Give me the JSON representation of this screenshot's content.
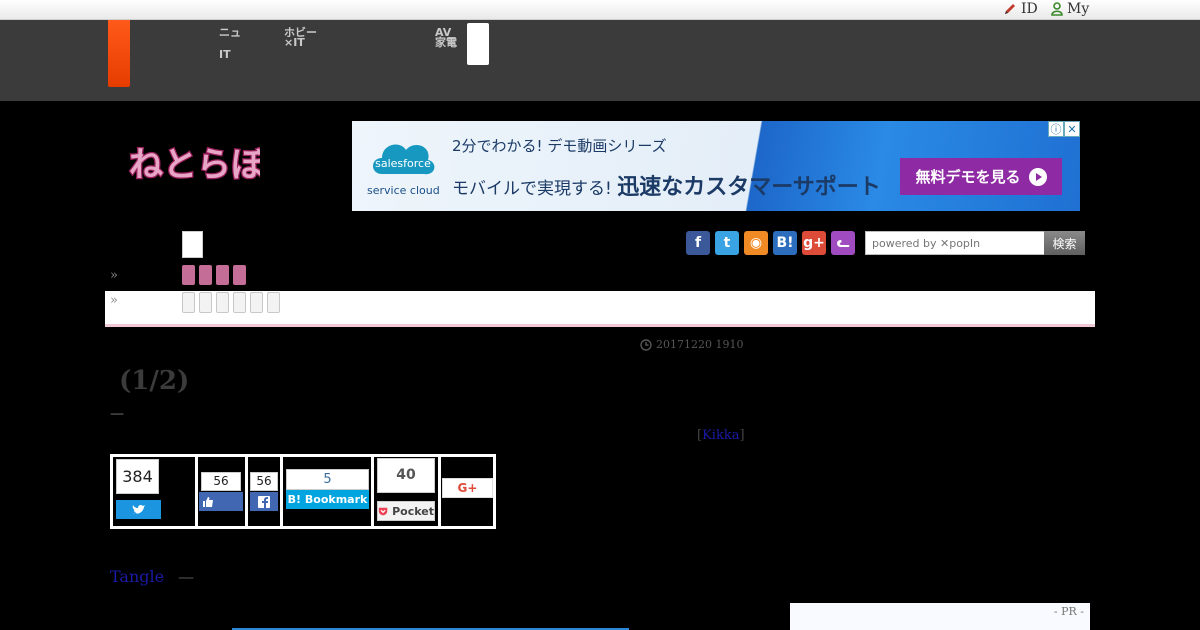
{
  "topbar": {
    "id_label": "ID",
    "my_label": "My"
  },
  "nav": {
    "items": [
      {
        "line1": "ニュ",
        "line2": "IT"
      },
      {
        "line1": "ホビー",
        "line2": "×IT"
      },
      {
        "line1": "AV",
        "line2": "家電"
      }
    ]
  },
  "logo": {
    "text": "ねとらぼ"
  },
  "ad": {
    "brand": "salesforce",
    "sub_brand": "service cloud",
    "line1": "2分でわかる! デモ動画シリーズ",
    "line2_prefix": "モバイルで実現する!",
    "line2_emphasis": "迅速なカスタマーサポート",
    "cta": "無料デモを見る",
    "info_icon": "ⓘ",
    "close_icon": "✕"
  },
  "breadcrumbs": {
    "marker1": "»",
    "marker2": "»"
  },
  "social_icons": [
    {
      "name": "facebook-icon",
      "glyph": "f",
      "color": "#3b5998"
    },
    {
      "name": "twitter-icon",
      "glyph": "t",
      "color": "#3aa3e3"
    },
    {
      "name": "rss-icon",
      "glyph": "◉",
      "color": "#f08a24"
    },
    {
      "name": "hatena-icon",
      "glyph": "B!",
      "color": "#2c6ebd"
    },
    {
      "name": "googleplus-icon",
      "glyph": "g+",
      "color": "#dd4b39"
    },
    {
      "name": "cat-icon",
      "glyph": "ᓚ",
      "color": "#a04cc0"
    }
  ],
  "search": {
    "placeholder": "powered by ✕popIn",
    "button": "検索"
  },
  "article": {
    "date": "20171220 1910",
    "title": "(1/2)",
    "dash": "—",
    "author_open": "[",
    "author_name": "Kikka",
    "author_close": "]"
  },
  "share": {
    "twitter_count": "384",
    "facebook_like_count": "56",
    "facebook_share_count": "56",
    "hatena_count": "5",
    "hatena_label": "B! Bookmark",
    "pocket_count": "40",
    "pocket_label": "Pocket",
    "gplus_label": "G+"
  },
  "tag": {
    "label": "Tangle",
    "dash": "—"
  },
  "pr": {
    "label": "- PR -"
  }
}
